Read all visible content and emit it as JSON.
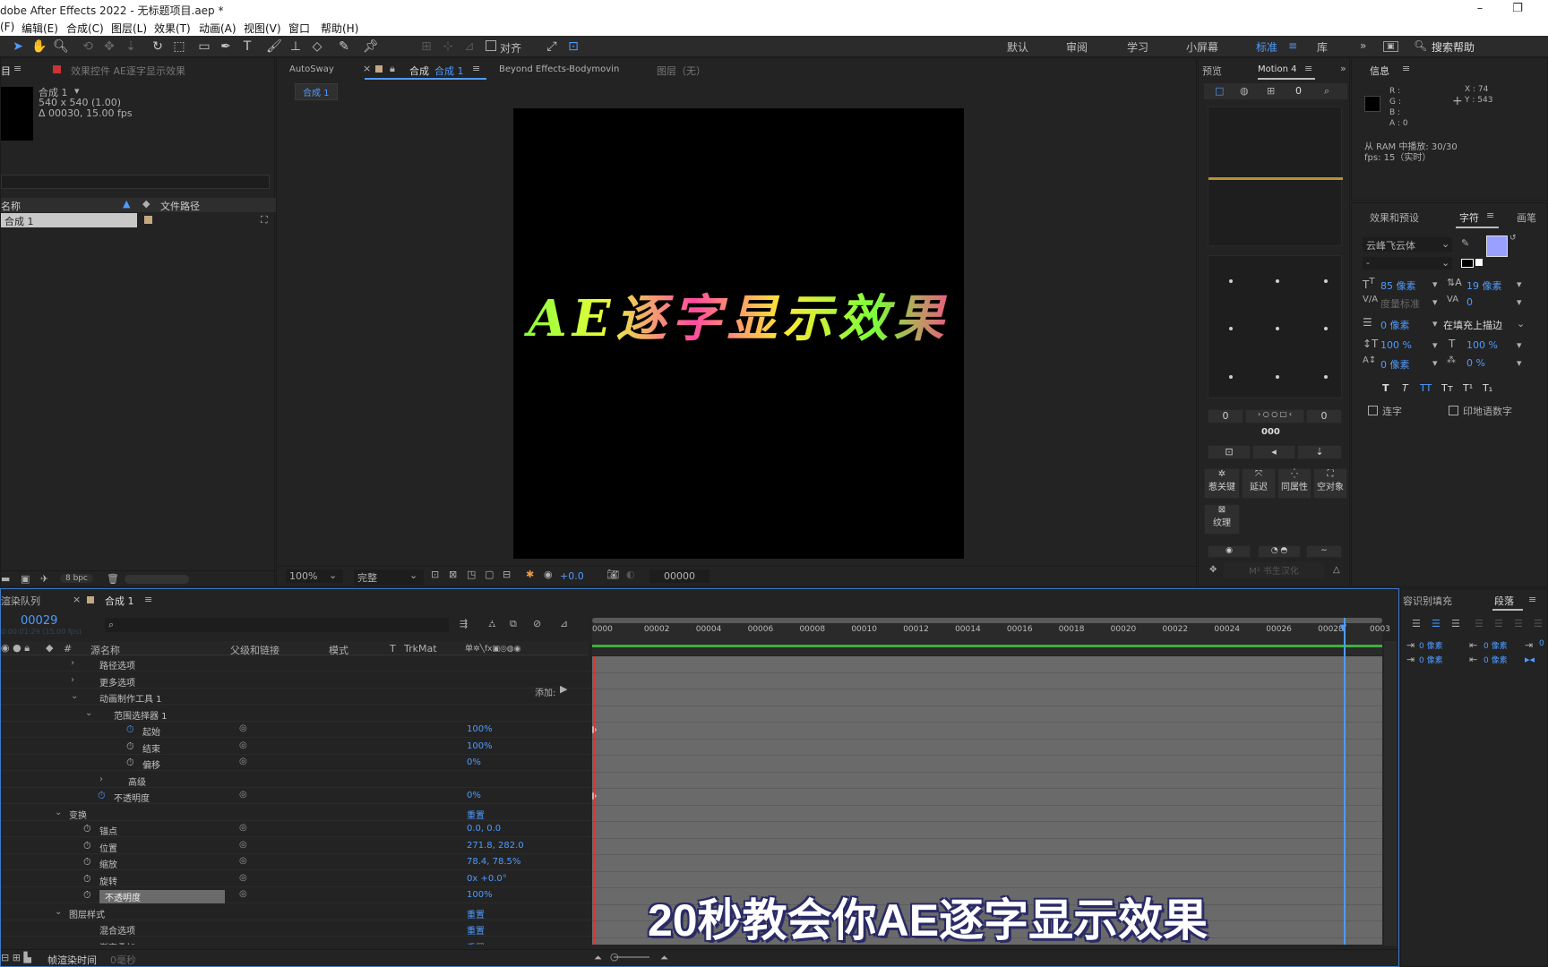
{
  "window": {
    "title": "dobe After Effects 2022 - 无标题项目.aep *",
    "minimize": "–",
    "restore": "❐"
  },
  "menu": [
    "(F)",
    "编辑(E)",
    "合成(C)",
    "图层(L)",
    "效果(T)",
    "动画(A)",
    "视图(V)",
    "窗口",
    "帮助(H)"
  ],
  "toolbar": {
    "snap_label": "对齐",
    "workspaces": [
      "默认",
      "审阅",
      "学习",
      "小屏幕",
      "标准",
      "库"
    ],
    "active_workspace": "标准",
    "search_placeholder": "搜索帮助"
  },
  "project": {
    "menu_label": "目",
    "effects_tab": "效果控件 AE逐字显示效果",
    "comp_name": "合成 1",
    "comp_size": "540 x 540 (1.00)",
    "comp_duration": "Δ 00030, 15.00 fps",
    "col_name": "名称",
    "col_path": "文件路径",
    "item": "合成 1",
    "bpc": "8 bpc"
  },
  "viewer": {
    "tabs": [
      "AutoSway",
      "合成",
      "合成 1",
      "Beyond Effects-Bodymovin"
    ],
    "layer_label": "图层（无）",
    "sub_tab": "合成 1",
    "comp_text": "AE逐字显示效果",
    "zoom": "100%",
    "quality": "完整",
    "exposure": "+0.0",
    "timecode": "00000"
  },
  "preview": {
    "tabs": [
      "预览",
      "Motion 4"
    ],
    "zero": "0",
    "n1": "0",
    "n2": "0",
    "btn_text": "000",
    "labels": [
      "惹关键",
      "延迟",
      "同属性",
      "空对象",
      "纹理"
    ],
    "footer": "M² 书生汉化"
  },
  "info": {
    "title": "信息",
    "r": "R :",
    "g": "G :",
    "b": "B :",
    "a": "A : 0",
    "x": "X : 74",
    "y": "Y : 543",
    "ram": "从 RAM 中播放: 30/30",
    "fps": "fps: 15（实时）"
  },
  "character": {
    "tabs": [
      "效果和预设",
      "字符",
      "画笔"
    ],
    "font": "云峰飞云体",
    "style": "-",
    "size": "85 像素",
    "leading": "19 像素",
    "kern": "度量标准",
    "track": "0",
    "stroke_w": "0 像素",
    "stroke_type": "在填充上描边",
    "vscale": "100 %",
    "hscale": "100 %",
    "baseline": "0 像素",
    "tsume": "0 %",
    "styles": [
      "T",
      "T",
      "TT",
      "Tт",
      "T¹",
      "T₁"
    ],
    "ligature": "连字",
    "hindi": "印地语数字",
    "fill_color": "#9aa0ff"
  },
  "paragraph": {
    "tabs": [
      "容识别填充",
      "段落"
    ],
    "indents": [
      "0 像素",
      "0 像素",
      "0 像素",
      "0 像素",
      "0"
    ]
  },
  "timeline": {
    "tabs": [
      "渲染队列",
      "合成 1"
    ],
    "timecode": "00029",
    "timecode_sub": "0:00:01:29 (15.00 fps)",
    "cols": [
      "#",
      "源名称",
      "父级和链接",
      "模式",
      "T",
      "TrkMat"
    ],
    "add_label": "添加:",
    "ruler": [
      "0000",
      "00002",
      "00004",
      "00006",
      "00008",
      "00010",
      "00012",
      "00014",
      "00016",
      "00018",
      "00020",
      "00022",
      "00024",
      "00026",
      "00028",
      "0003"
    ],
    "footer": "帧渲染时间",
    "footer_val": "0毫秒",
    "current_frame": 29,
    "total_frames": 30
  },
  "layers": [
    {
      "name": "路径选项",
      "val": "",
      "indent": 0
    },
    {
      "name": "更多选项",
      "val": "",
      "indent": 0
    },
    {
      "name": "动画制作工具 1",
      "val": "",
      "indent": 0
    },
    {
      "name": "范围选择器 1",
      "val": "",
      "indent": 1
    },
    {
      "name": "起始",
      "val": "100%",
      "indent": 3
    },
    {
      "name": "结束",
      "val": "100%",
      "indent": 3
    },
    {
      "name": "偏移",
      "val": "0%",
      "indent": 3
    },
    {
      "name": "高级",
      "val": "",
      "indent": 2
    },
    {
      "name": "不透明度",
      "val": "0%",
      "indent": 1
    },
    {
      "name": "变换",
      "val": "重置",
      "indent": -1
    },
    {
      "name": "锚点",
      "val": "0.0, 0.0",
      "indent": 0
    },
    {
      "name": "位置",
      "val": "271.8, 282.0",
      "indent": 0
    },
    {
      "name": "缩放",
      "val": "78.4, 78.5%",
      "indent": 0
    },
    {
      "name": "旋转",
      "val": "0x +0.0°",
      "indent": 0
    },
    {
      "name": "不透明度",
      "val": "100%",
      "indent": 0
    },
    {
      "name": "图层样式",
      "val": "重置",
      "indent": -1
    },
    {
      "name": "混合选项",
      "val": "重置",
      "indent": 0
    },
    {
      "name": "渐变叠加",
      "val": "重置",
      "indent": 0
    }
  ],
  "caption": "20秒教会你AE逐字显示效果"
}
